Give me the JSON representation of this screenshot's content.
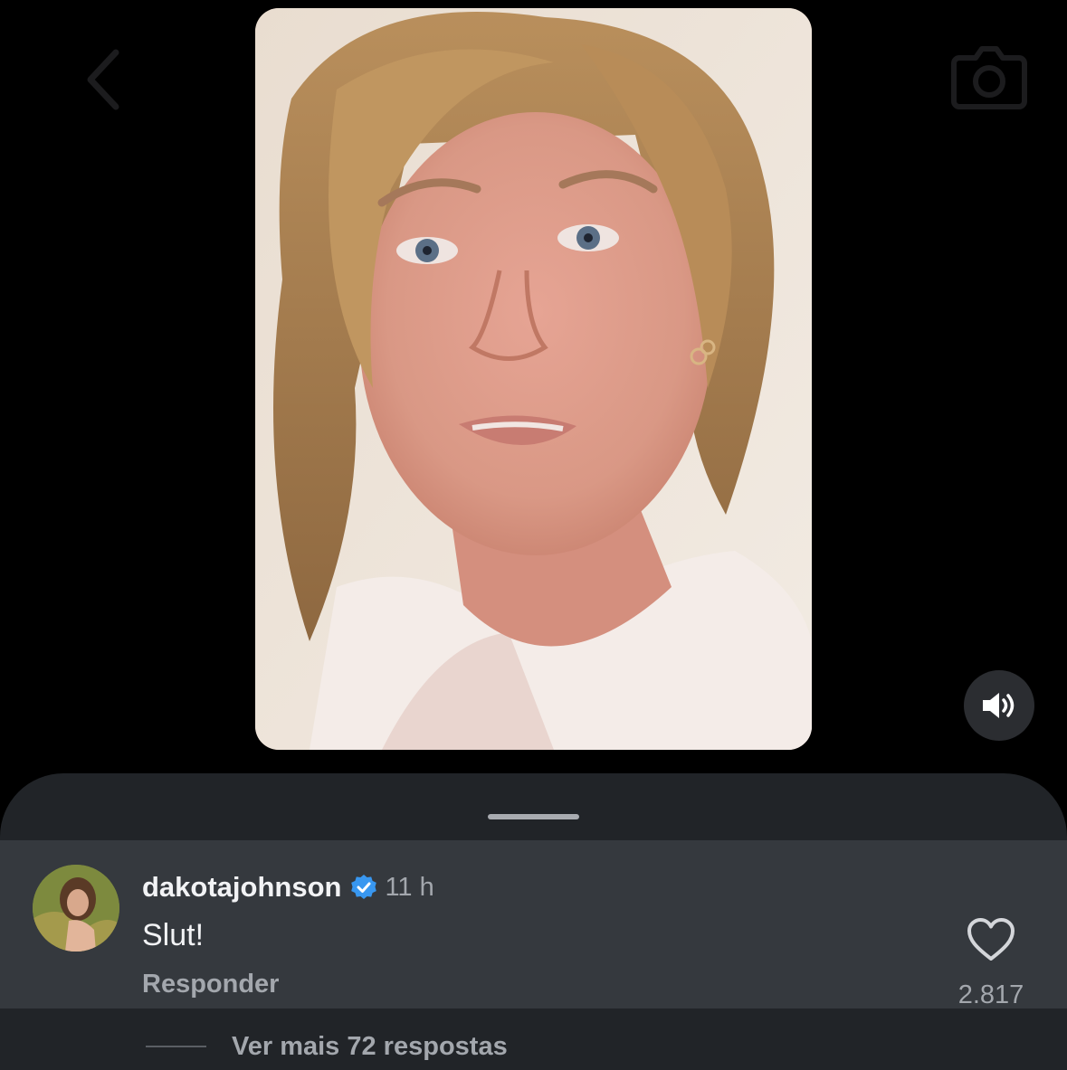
{
  "nav": {
    "back_icon": "chevron-left-icon",
    "camera_icon": "camera-icon"
  },
  "video": {
    "sound_icon": "speaker-on-icon"
  },
  "comment": {
    "username": "dakotajohnson",
    "verified": true,
    "time": "11 h",
    "text": "Slut!",
    "reply_label": "Responder",
    "like_icon": "heart-outline-icon",
    "like_count": "2.817"
  },
  "replies": {
    "more_label": "Ver mais 72 respostas"
  },
  "colors": {
    "sheet_bg": "#212428",
    "comment_bg": "#35393e",
    "verified_blue": "#3897f0",
    "secondary_text": "#a3a7ad"
  }
}
